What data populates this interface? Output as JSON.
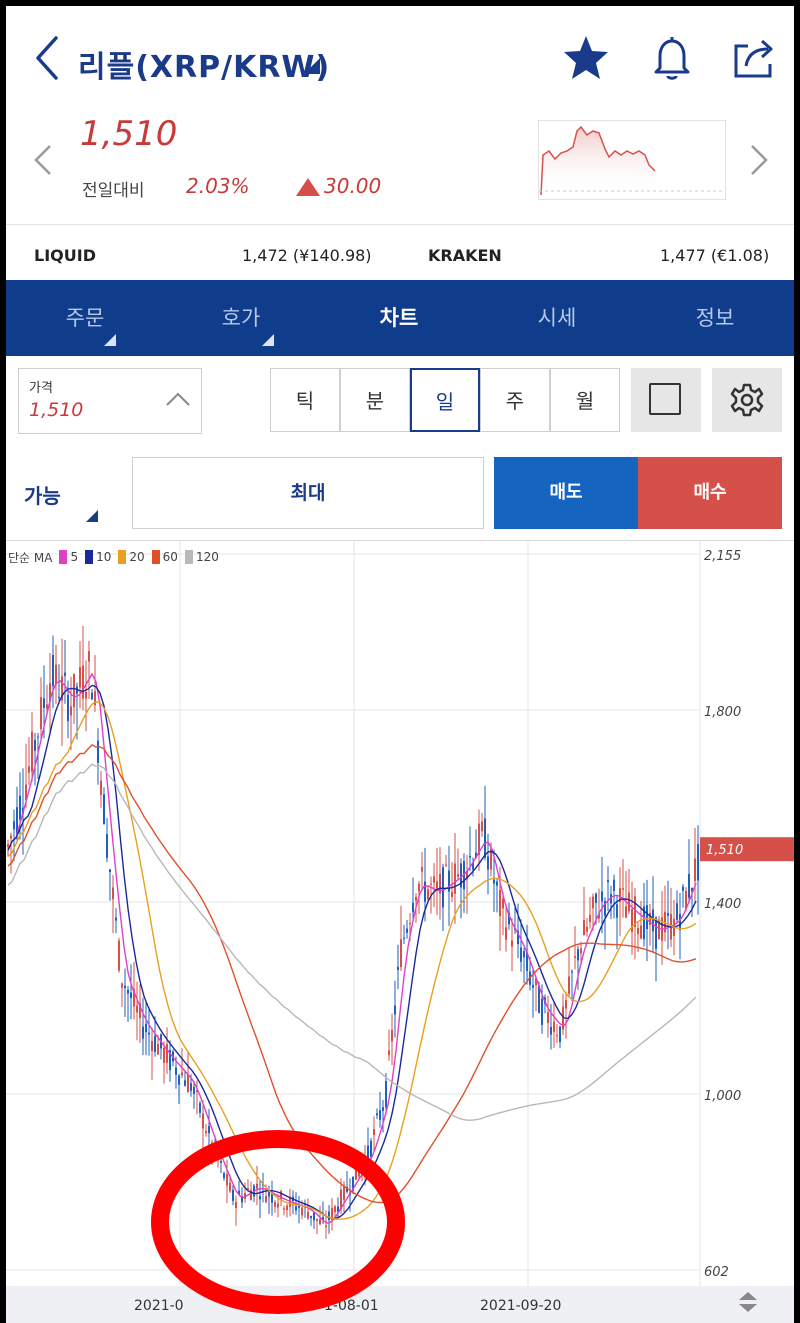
{
  "header": {
    "title": "리플(XRP/KRW)",
    "price": "1,510",
    "change_label": "전일대비",
    "change_pct": "2.03%",
    "change_amt": "30.00"
  },
  "exchanges": [
    {
      "name": "LIQUID",
      "value": "1,472 (¥140.98)"
    },
    {
      "name": "KRAKEN",
      "value": "1,477 (€1.08)"
    }
  ],
  "tabs": [
    {
      "label": "주문",
      "has_menu": true
    },
    {
      "label": "호가",
      "has_menu": true
    },
    {
      "label": "차트",
      "active": true
    },
    {
      "label": "시세"
    },
    {
      "label": "정보"
    }
  ],
  "controls": {
    "price_label": "가격",
    "price_value": "1,510",
    "periods": [
      "틱",
      "분",
      "일",
      "주",
      "월"
    ],
    "selected_period": "일",
    "available_label": "가능",
    "qty_label": "최대",
    "sell_label": "매도",
    "buy_label": "매수"
  },
  "chart": {
    "ma_title": "단순 MA",
    "ma_legend": [
      {
        "label": "5",
        "color": "#e040c8"
      },
      {
        "label": "10",
        "color": "#1a2a9a"
      },
      {
        "label": "20",
        "color": "#e8a020"
      },
      {
        "label": "60",
        "color": "#e0502a"
      },
      {
        "label": "120",
        "color": "#b8b8b8"
      }
    ],
    "y_ticks": [
      {
        "label": "2,155",
        "value": 2155
      },
      {
        "label": "1,800",
        "value": 1800
      },
      {
        "label": "1,400",
        "value": 1400
      },
      {
        "label": "1,000",
        "value": 1000
      },
      {
        "label": "602",
        "value": 602
      }
    ],
    "current_price_label": "1,510",
    "x_labels": [
      "2021-0",
      "1-08-01",
      "2021-09-20"
    ],
    "colors": {
      "up": "#d6504a",
      "down": "#1f5fbf",
      "current_price": "#d6504a",
      "annotation": "#ff0000"
    }
  }
}
